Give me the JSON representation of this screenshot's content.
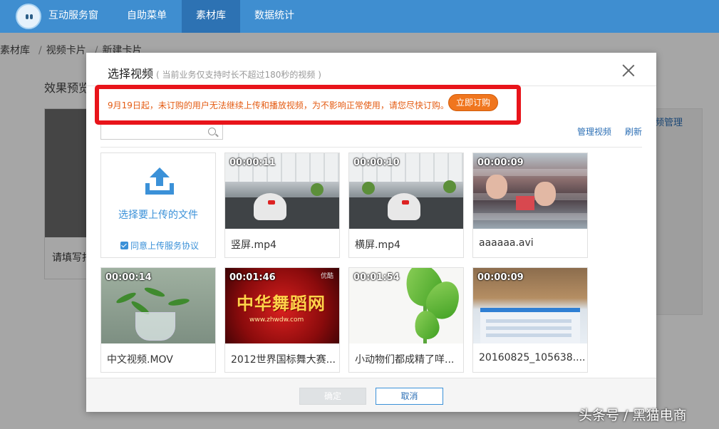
{
  "nav": {
    "brand": "互动服务窗",
    "menu": "自助菜单",
    "library": "素材库",
    "stats": "数据统计"
  },
  "breadcrumb": [
    "素材库",
    "视频卡片",
    "新建卡片"
  ],
  "background": {
    "preview_label": "效果预览",
    "card_text": "请填写打",
    "right_panel_text": "频管理"
  },
  "modal": {
    "title": "选择视频",
    "subtitle": "( 当前业务仅支持时长不超过180秒的视频 )",
    "notice": "9月19日起，未订购的用户无法继续上传和播放视频，为不影响正常使用，请您尽快订购。",
    "subscribe_label": "立即订购",
    "manage_label": "管理视频",
    "refresh_label": "刷新",
    "upload_label": "选择要上传的文件",
    "agree_label": "同意上传服务协议",
    "ok_label": "确定",
    "cancel_label": "取消"
  },
  "videos": [
    {
      "duration": "00:00:11",
      "name": "竖屏.mp4"
    },
    {
      "duration": "00:00:10",
      "name": "横屏.mp4"
    },
    {
      "duration": "00:00:09",
      "name": "aaaaaa.avi"
    },
    {
      "duration": "00:00:14",
      "name": "中文视频.MOV"
    },
    {
      "duration": "00:01:46",
      "name": "2012世界国标舞大赛..."
    },
    {
      "duration": "00:01:54",
      "name": "小动物们都成精了咩..."
    },
    {
      "duration": "00:00:09",
      "name": "20160825_105638...."
    }
  ],
  "thumb_text": {
    "dance_title": "中华舞蹈网",
    "dance_url": "www.zhwdw.com",
    "dance_corner": "优酷"
  },
  "watermark": "头条号 / 黑猫电商",
  "colors": {
    "nav": "#3f8ed0",
    "nav_active": "#2d72b3",
    "link": "#2c6fb5",
    "notice_text": "#e45b12",
    "notice_border": "#e8141a",
    "subscribe": "#f0761e"
  }
}
